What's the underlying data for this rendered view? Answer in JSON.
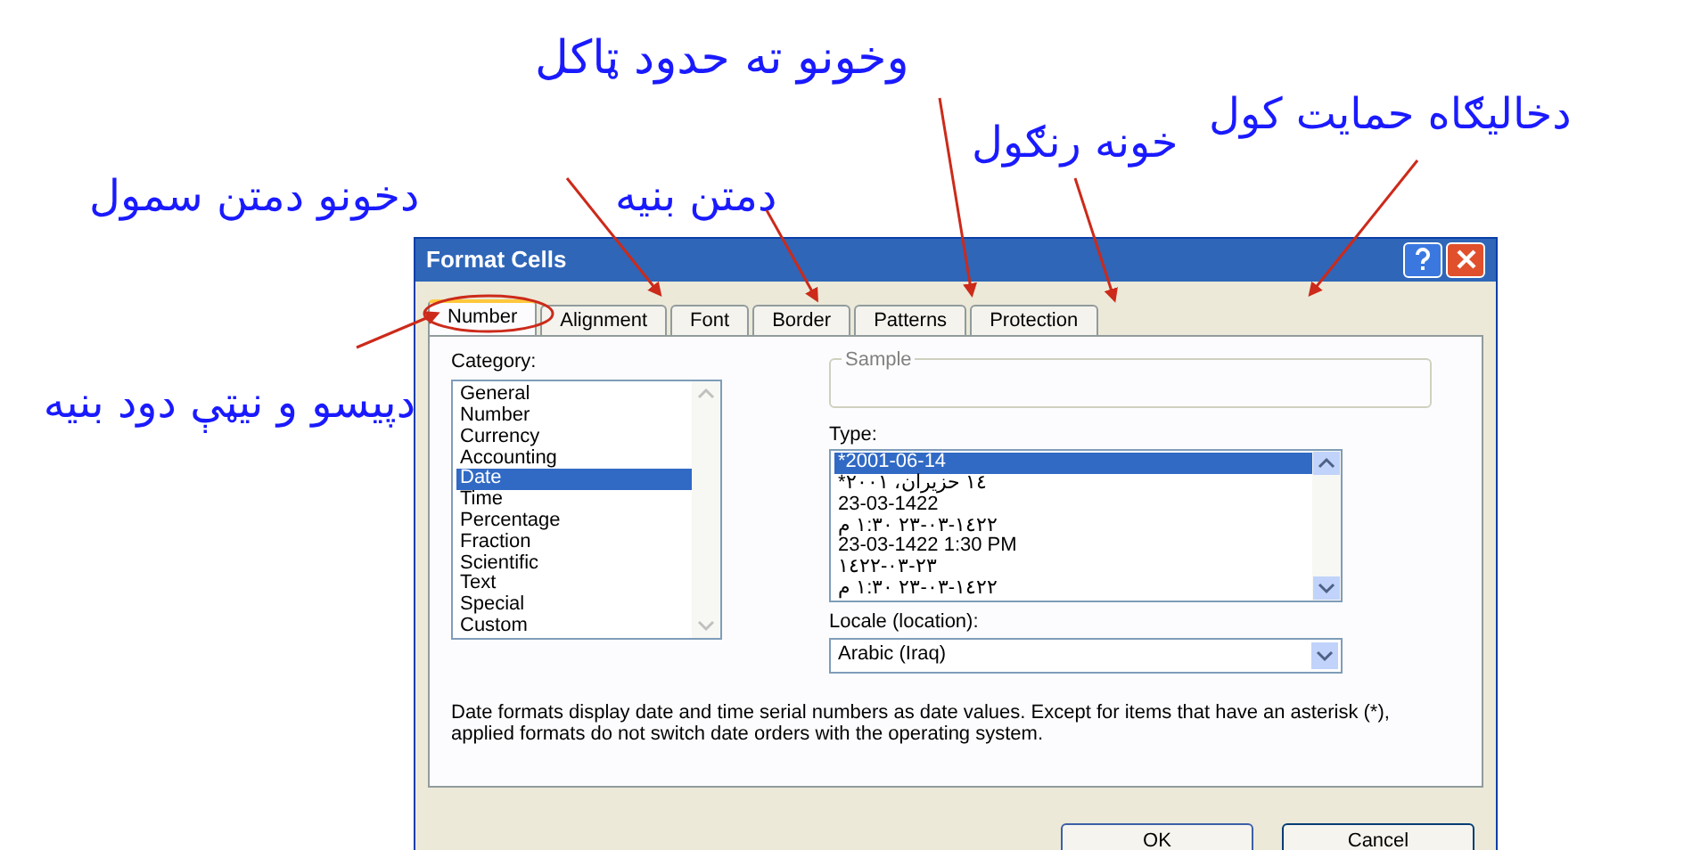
{
  "annotations": [
    {
      "text": "وخونو ته حدود ټاکل"
    },
    {
      "text": "دخاليګاه حمايت کول"
    },
    {
      "text": "خونه رنګول"
    },
    {
      "text": "دمتن بنیه"
    },
    {
      "text": "دخونو دمتن سمول"
    },
    {
      "text": "دپيسو و نيټې دود بنيه"
    }
  ],
  "dialog": {
    "title": "Format Cells",
    "tabs": [
      {
        "label": "Number",
        "selected": true
      },
      {
        "label": "Alignment",
        "selected": false
      },
      {
        "label": "Font",
        "selected": false
      },
      {
        "label": "Border",
        "selected": false
      },
      {
        "label": "Patterns",
        "selected": false
      },
      {
        "label": "Protection",
        "selected": false
      }
    ],
    "category_label": "Category:",
    "categories": [
      {
        "label": "General",
        "selected": false
      },
      {
        "label": "Number",
        "selected": false
      },
      {
        "label": "Currency",
        "selected": false
      },
      {
        "label": "Accounting",
        "selected": false
      },
      {
        "label": "Date",
        "selected": true
      },
      {
        "label": "Time",
        "selected": false
      },
      {
        "label": "Percentage",
        "selected": false
      },
      {
        "label": "Fraction",
        "selected": false
      },
      {
        "label": "Scientific",
        "selected": false
      },
      {
        "label": "Text",
        "selected": false
      },
      {
        "label": "Special",
        "selected": false
      },
      {
        "label": "Custom",
        "selected": false
      }
    ],
    "sample_label": "Sample",
    "type_label": "Type:",
    "types": [
      {
        "label": "*2001-06-14",
        "selected": true
      },
      {
        "label": "*١٤ حزيران، ٢٠٠١",
        "selected": false
      },
      {
        "label": "23-03-1422",
        "selected": false
      },
      {
        "label": "١٤٢٢-٠٣-٢٣ ١:٣٠ م",
        "selected": false
      },
      {
        "label": "23-03-1422 1:30 PM",
        "selected": false
      },
      {
        "label": "٢٣-٠٣-١٤٢٢",
        "selected": false
      },
      {
        "label": "١٤٢٢-٠٣-٢٣ ١:٣٠ م",
        "selected": false
      }
    ],
    "locale_label": "Locale (location):",
    "locale_value": "Arabic (Iraq)",
    "description": "Date formats display date and time serial numbers as date values. Except for items that have an asterisk (*), applied formats do not switch date orders with the operating system.",
    "buttons": [
      "OK",
      "Cancel"
    ]
  }
}
